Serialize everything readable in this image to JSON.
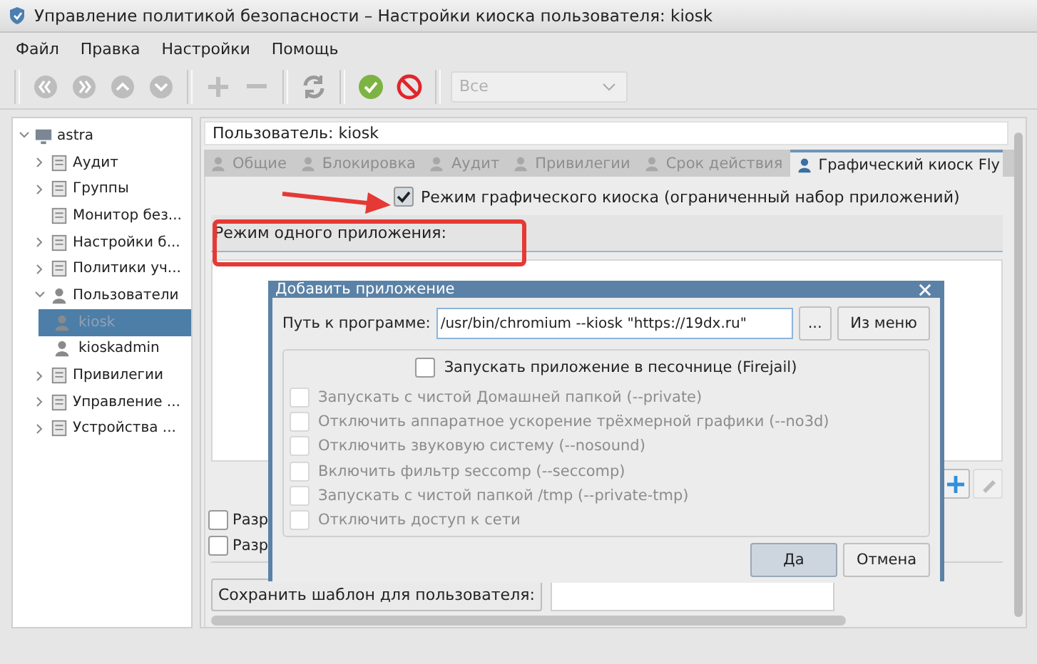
{
  "window": {
    "title": "Управление политикой безопасности – Настройки киоска пользователя: kiosk"
  },
  "menu": [
    "Файл",
    "Правка",
    "Настройки",
    "Помощь"
  ],
  "toolbar": {
    "buttons": [
      {
        "kind": "first",
        "disabled": true
      },
      {
        "kind": "last",
        "disabled": true
      },
      {
        "kind": "up",
        "disabled": true
      },
      {
        "kind": "down",
        "disabled": true
      },
      {
        "kind": "add",
        "disabled": true
      },
      {
        "kind": "remove",
        "disabled": true
      },
      {
        "kind": "refresh",
        "disabled": true
      },
      {
        "kind": "apply",
        "disabled": false
      },
      {
        "kind": "cancel",
        "disabled": false
      }
    ],
    "filter": {
      "value": "Все",
      "disabled": true
    }
  },
  "tree": {
    "label": "astra",
    "expanded": true,
    "children": [
      {
        "label": "Аудит",
        "expandable": true,
        "expanded": false
      },
      {
        "label": "Группы",
        "expandable": true,
        "expanded": false
      },
      {
        "label": "Монитор без...",
        "expandable": false
      },
      {
        "label": "Настройки б...",
        "expandable": true,
        "expanded": false
      },
      {
        "label": "Политики уч...",
        "expandable": true,
        "expanded": false
      },
      {
        "label": "Пользователи",
        "expandable": true,
        "expanded": true,
        "children": [
          {
            "label": "kiosk",
            "selected": true
          },
          {
            "label": "kioskadmin",
            "selected": false
          }
        ]
      },
      {
        "label": "Привилегии",
        "expandable": true,
        "expanded": false
      },
      {
        "label": "Управление ...",
        "expandable": true,
        "expanded": false
      },
      {
        "label": "Устройства ...",
        "expandable": true,
        "expanded": false
      }
    ]
  },
  "user_label": "Пользователь: kiosk",
  "tabs": [
    {
      "label": "Общие",
      "selected": false
    },
    {
      "label": "Блокировка",
      "selected": false
    },
    {
      "label": "Аудит",
      "selected": false
    },
    {
      "label": "Привилегии",
      "selected": false
    },
    {
      "label": "Срок действия",
      "selected": false
    },
    {
      "label": "Графический киоск Fly",
      "selected": true
    }
  ],
  "kiosk_mode": {
    "label": "Режим графического киоска (ограниченный набор приложений)",
    "checked": true
  },
  "single_app": {
    "label": "Режим одного приложения:"
  },
  "options": [
    {
      "label": "Разр",
      "checked": false
    },
    {
      "label": "Разр",
      "checked": false
    }
  ],
  "save_template": {
    "label": "Сохранить шаблон для пользователя:"
  },
  "dialog": {
    "title": "Добавить приложение",
    "path_label": "Путь к программе:",
    "path_value": "/usr/bin/chromium --kiosk \"https://19dx.ru\"",
    "browse": "...",
    "from_menu": "Из меню",
    "sandbox": {
      "label": "Запускать приложение в песочнице (Firejail)",
      "checked": false
    },
    "sandbox_options": [
      {
        "label": "Запускать с чистой Домашней папкой (--private)",
        "checked": false,
        "disabled": true
      },
      {
        "label": "Отключить аппаратное ускорение трёхмерной графики (--no3d)",
        "checked": false,
        "disabled": true
      },
      {
        "label": "Отключить звуковую систему (--nosound)",
        "checked": false,
        "disabled": true
      },
      {
        "label": "Включить фильтр seccomp (--seccomp)",
        "checked": false,
        "disabled": true
      },
      {
        "label": "Запускать с чистой папкой /tmp (--private-tmp)",
        "checked": false,
        "disabled": true
      },
      {
        "label": "Отключить доступ к сети",
        "checked": false,
        "disabled": true
      }
    ],
    "ok": "Да",
    "cancel": "Отмена"
  }
}
